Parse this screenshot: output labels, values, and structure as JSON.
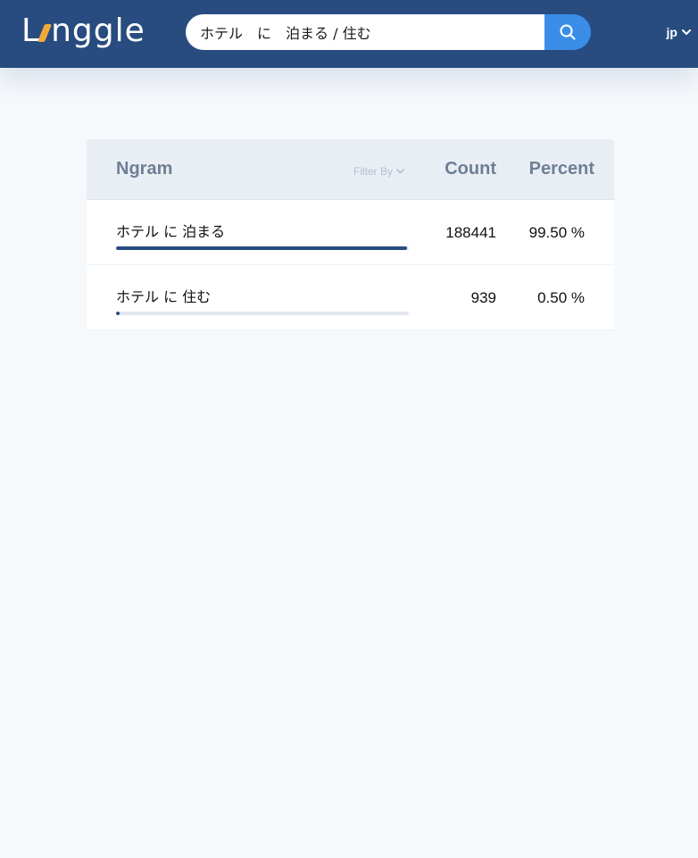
{
  "header": {
    "logo_text": "Linggle",
    "search": {
      "value": "ホテル　に　泊まる / 住む",
      "icon": "search-icon"
    },
    "language": "jp"
  },
  "table": {
    "headers": {
      "ngram": "Ngram",
      "filter": "Filter By",
      "count": "Count",
      "percent": "Percent"
    },
    "rows": [
      {
        "ngram": "ホテル に 泊まる",
        "count": "188441",
        "percent": "99.50 %",
        "share": 0.995
      },
      {
        "ngram": "ホテル に 住む",
        "count": "939",
        "percent": "0.50 %",
        "share": 0.005
      }
    ]
  },
  "colors": {
    "navbar": "#284c80",
    "search_button": "#3b8ee8",
    "logo_accent": "#f2a93b",
    "bar_fill": "#284c80",
    "background": "#f6f9fc"
  }
}
